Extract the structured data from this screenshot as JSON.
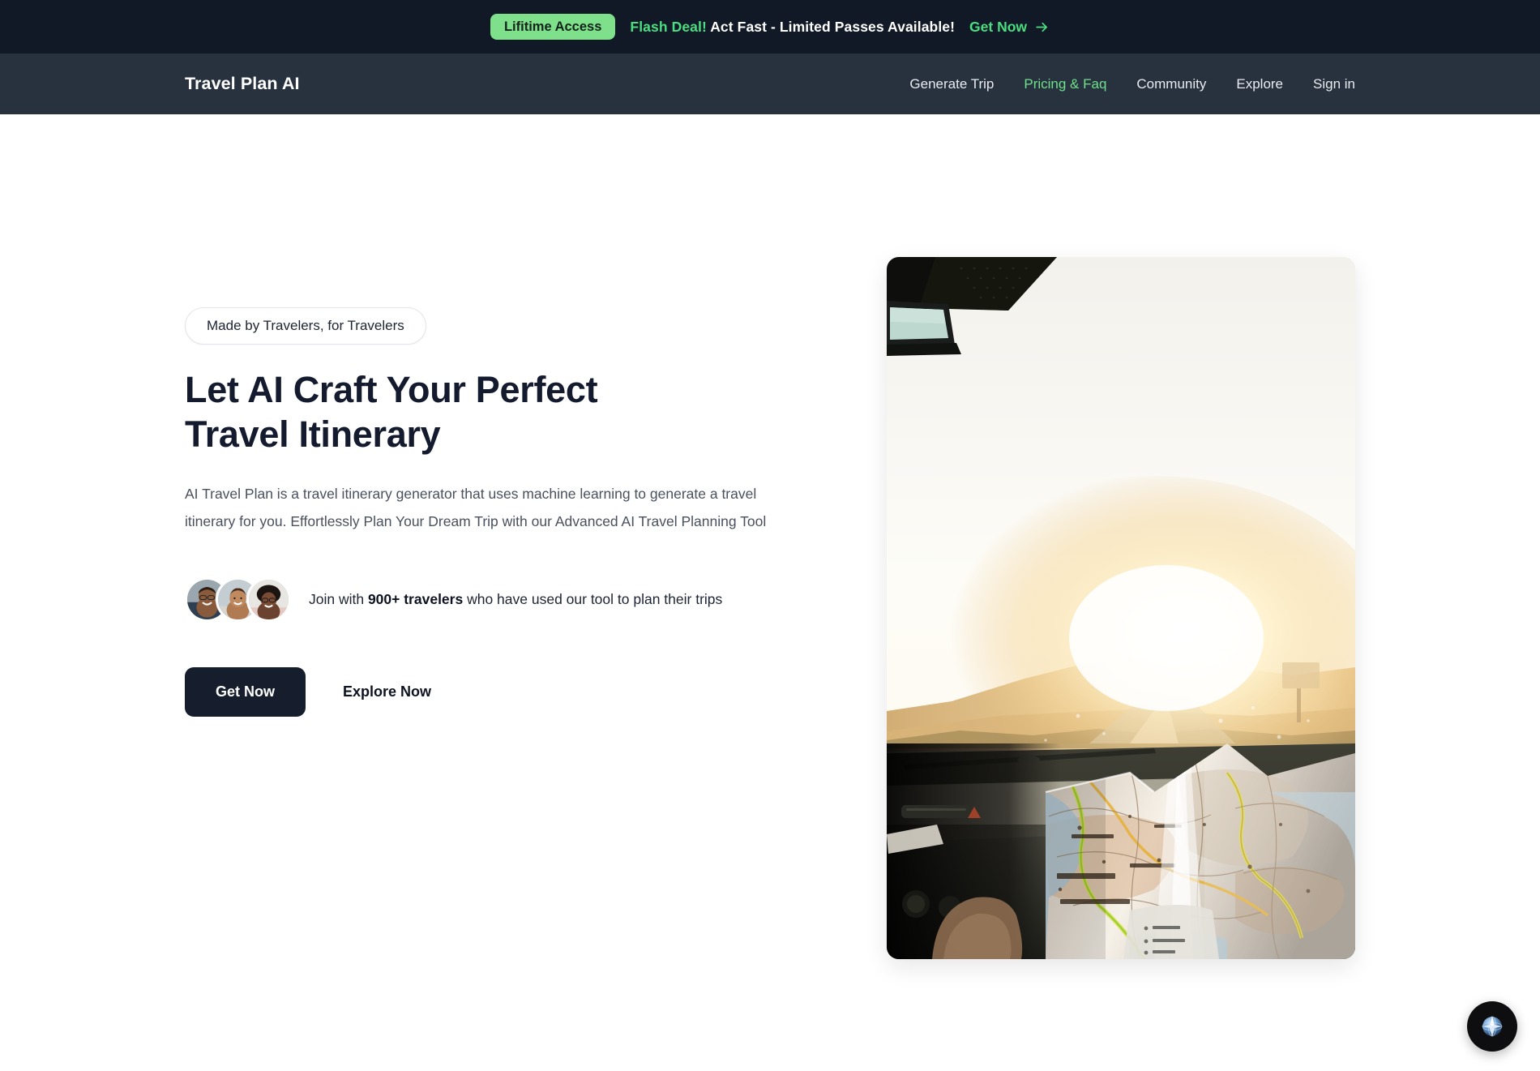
{
  "promo_banner": {
    "pill_label": "Lifitime Access",
    "highlight": "Flash Deal!",
    "message": " Act Fast - Limited Passes Available!",
    "cta_label": "Get Now",
    "pill_bg": "#7ee08a",
    "accent_color": "#4ade80",
    "background": "#111826"
  },
  "navbar": {
    "brand": "Travel Plan AI",
    "background": "#28323f",
    "active_color": "#6ee08a",
    "links": [
      {
        "label": "Generate Trip",
        "active": false
      },
      {
        "label": "Pricing & Faq",
        "active": true
      },
      {
        "label": "Community",
        "active": false
      },
      {
        "label": "Explore",
        "active": false
      },
      {
        "label": "Sign in",
        "active": false
      }
    ]
  },
  "hero": {
    "badge": "Made by Travelers, for Travelers",
    "title": "Let AI Craft Your Perfect Travel Itinerary",
    "description": "AI Travel Plan is a travel itinerary generator that uses machine learning to generate a travel itinerary for you. Effortlessly Plan Your Dream Trip with our Advanced AI Travel Planning Tool",
    "social_proof": {
      "prefix": "Join with ",
      "count": "900+ travelers",
      "suffix": " who have used our tool to plan their trips",
      "avatar_count": 3
    },
    "primary_button": "Get Now",
    "secondary_button": "Explore Now",
    "title_color": "#141b2e",
    "primary_button_bg": "#161e2e",
    "image_alt": "View through car windshield at sunset with a folded Iceland road map and sun hat on the dashboard"
  },
  "float_widget": {
    "icon": "globe-compass-icon",
    "background": "#0e0e10"
  }
}
